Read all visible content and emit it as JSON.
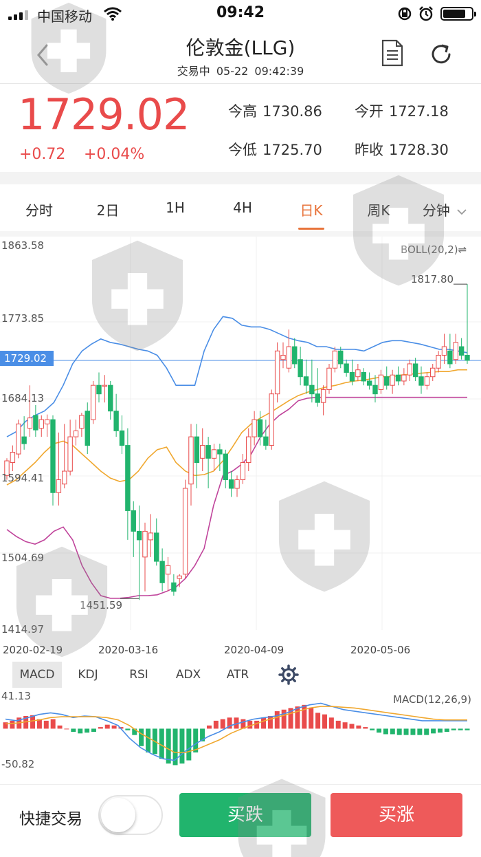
{
  "status_bar": {
    "carrier": "中国移动",
    "time": "09:42"
  },
  "header": {
    "title": "伦敦金(LLG)",
    "status": "交易中",
    "date": "05-22",
    "clock": "09:42:39"
  },
  "quote": {
    "price": "1729.02",
    "change": "+0.72",
    "change_pct": "+0.04%",
    "high_label": "今高",
    "high": "1730.86",
    "open_label": "今开",
    "open": "1727.18",
    "low_label": "今低",
    "low": "1725.70",
    "prev_close_label": "昨收",
    "prev_close": "1728.30"
  },
  "period_tabs": [
    {
      "label": "分时"
    },
    {
      "label": "2日"
    },
    {
      "label": "1H"
    },
    {
      "label": "4H"
    },
    {
      "label": "日K",
      "active": true
    },
    {
      "label": "周K"
    },
    {
      "label": "分钟"
    }
  ],
  "chart": {
    "overlay_label": "BOLL(20,2)",
    "current_price_tag": "1729.02",
    "max_annotation": "1817.80",
    "min_annotation": "1451.59",
    "y_ticks": [
      "1863.58",
      "1773.85",
      "1684.13",
      "1594.41",
      "1504.69",
      "1414.97"
    ],
    "x_ticks": [
      "2020-02-19",
      "2020-03-16",
      "2020-04-09",
      "2020-05-06"
    ],
    "colors": {
      "up": "#e94b4b",
      "down": "#21b46d",
      "upper": "#4a8ee6",
      "mid": "#f0a830",
      "lower": "#c0449b"
    }
  },
  "indicator_tabs": [
    {
      "label": "MACD",
      "active": true
    },
    {
      "label": "KDJ"
    },
    {
      "label": "RSI"
    },
    {
      "label": "ADX"
    },
    {
      "label": "ATR"
    }
  ],
  "macd": {
    "label": "MACD(12,26,9)",
    "top": "41.13",
    "bottom": "-50.82"
  },
  "chart_data": {
    "type": "candlestick",
    "title": "伦敦金(LLG) 日K",
    "x_range": [
      "2020-02-19",
      "2020-05-22"
    ],
    "ylim": [
      1414.97,
      1863.58
    ],
    "ohlc": [
      [
        1595,
        1615,
        1590,
        1612
      ],
      [
        1610,
        1630,
        1600,
        1622
      ],
      [
        1620,
        1660,
        1615,
        1655
      ],
      [
        1640,
        1664,
        1625,
        1632
      ],
      [
        1650,
        1700,
        1640,
        1662
      ],
      [
        1665,
        1677,
        1640,
        1648
      ],
      [
        1650,
        1665,
        1640,
        1660
      ],
      [
        1655,
        1666,
        1640,
        1660
      ],
      [
        1660,
        1665,
        1560,
        1575
      ],
      [
        1575,
        1645,
        1560,
        1590
      ],
      [
        1585,
        1655,
        1580,
        1600
      ],
      [
        1600,
        1660,
        1595,
        1640
      ],
      [
        1640,
        1660,
        1630,
        1647
      ],
      [
        1650,
        1668,
        1640,
        1665
      ],
      [
        1670,
        1680,
        1620,
        1630
      ],
      [
        1660,
        1705,
        1655,
        1700
      ],
      [
        1700,
        1715,
        1680,
        1690
      ],
      [
        1700,
        1712,
        1680,
        1700
      ],
      [
        1700,
        1705,
        1660,
        1670
      ],
      [
        1670,
        1690,
        1640,
        1647
      ],
      [
        1647,
        1665,
        1620,
        1630
      ],
      [
        1630,
        1650,
        1520,
        1554
      ],
      [
        1554,
        1565,
        1500,
        1530
      ],
      [
        1530,
        1560,
        1450,
        1520
      ],
      [
        1500,
        1540,
        1460,
        1530
      ],
      [
        1520,
        1550,
        1500,
        1528
      ],
      [
        1528,
        1545,
        1490,
        1495
      ],
      [
        1495,
        1510,
        1460,
        1470
      ],
      [
        1480,
        1500,
        1460,
        1490
      ],
      [
        1470,
        1480,
        1455,
        1460
      ],
      [
        1475,
        1480,
        1465,
        1478
      ],
      [
        1480,
        1590,
        1475,
        1580
      ],
      [
        1585,
        1655,
        1560,
        1640
      ],
      [
        1640,
        1655,
        1580,
        1610
      ],
      [
        1615,
        1650,
        1600,
        1630
      ],
      [
        1630,
        1640,
        1580,
        1615
      ],
      [
        1615,
        1632,
        1600,
        1625
      ],
      [
        1625,
        1632,
        1600,
        1620
      ],
      [
        1620,
        1625,
        1580,
        1590
      ],
      [
        1590,
        1600,
        1570,
        1580
      ],
      [
        1580,
        1595,
        1570,
        1590
      ],
      [
        1590,
        1620,
        1585,
        1610
      ],
      [
        1610,
        1650,
        1600,
        1640
      ],
      [
        1640,
        1670,
        1630,
        1660
      ],
      [
        1660,
        1670,
        1630,
        1640
      ],
      [
        1640,
        1660,
        1625,
        1630
      ],
      [
        1630,
        1695,
        1625,
        1690
      ],
      [
        1690,
        1750,
        1680,
        1740
      ],
      [
        1730,
        1750,
        1720,
        1735
      ],
      [
        1720,
        1765,
        1715,
        1745
      ],
      [
        1745,
        1755,
        1720,
        1725
      ],
      [
        1730,
        1745,
        1700,
        1710
      ],
      [
        1710,
        1730,
        1690,
        1700
      ],
      [
        1700,
        1730,
        1680,
        1690
      ],
      [
        1690,
        1720,
        1675,
        1680
      ],
      [
        1680,
        1700,
        1665,
        1695
      ],
      [
        1695,
        1725,
        1690,
        1720
      ],
      [
        1720,
        1745,
        1715,
        1740
      ],
      [
        1740,
        1745,
        1720,
        1725
      ],
      [
        1725,
        1730,
        1710,
        1715
      ],
      [
        1715,
        1730,
        1700,
        1705
      ],
      [
        1710,
        1725,
        1705,
        1718
      ],
      [
        1715,
        1720,
        1700,
        1705
      ],
      [
        1705,
        1715,
        1695,
        1700
      ],
      [
        1700,
        1712,
        1680,
        1690
      ],
      [
        1695,
        1718,
        1690,
        1712
      ],
      [
        1710,
        1722,
        1695,
        1700
      ],
      [
        1700,
        1718,
        1690,
        1712
      ],
      [
        1712,
        1722,
        1700,
        1705
      ],
      [
        1705,
        1720,
        1700,
        1712
      ],
      [
        1712,
        1730,
        1705,
        1725
      ],
      [
        1725,
        1732,
        1705,
        1710
      ],
      [
        1710,
        1722,
        1690,
        1700
      ],
      [
        1700,
        1715,
        1695,
        1710
      ],
      [
        1710,
        1725,
        1705,
        1720
      ],
      [
        1720,
        1740,
        1715,
        1735
      ],
      [
        1735,
        1760,
        1725,
        1745
      ],
      [
        1740,
        1760,
        1720,
        1725
      ],
      [
        1730,
        1760,
        1725,
        1750
      ],
      [
        1745,
        1755,
        1730,
        1735
      ],
      [
        1735,
        1817.8,
        1725,
        1729.02
      ]
    ],
    "series": [
      {
        "name": "BOLL upper",
        "values": [
          1640,
          1646,
          1658,
          1665,
          1670,
          1680,
          1700,
          1725,
          1740,
          1748,
          1754,
          1750,
          1748,
          1745,
          1742,
          1740,
          1735,
          1720,
          1700,
          1700,
          1700,
          1740,
          1765,
          1780,
          1778,
          1770,
          1768,
          1768,
          1765,
          1760,
          1755,
          1752,
          1750,
          1745,
          1745,
          1742,
          1742,
          1742,
          1740,
          1745,
          1750,
          1752,
          1752,
          1750,
          1748,
          1745,
          1742,
          1742,
          1740,
          1738
        ]
      },
      {
        "name": "BOLL mid",
        "values": [
          1584,
          1590,
          1600,
          1610,
          1622,
          1632,
          1635,
          1630,
          1620,
          1610,
          1600,
          1592,
          1588,
          1590,
          1600,
          1615,
          1625,
          1628,
          1610,
          1600,
          1595,
          1596,
          1600,
          1612,
          1628,
          1645,
          1655,
          1662,
          1668,
          1675,
          1682,
          1688,
          1692,
          1695,
          1698,
          1700,
          1703,
          1705,
          1706,
          1708,
          1710,
          1710,
          1712,
          1713,
          1714,
          1715,
          1716,
          1716,
          1718,
          1718
        ]
      },
      {
        "name": "BOLL lower",
        "values": [
          1532,
          1524,
          1518,
          1515,
          1520,
          1530,
          1535,
          1520,
          1490,
          1470,
          1455,
          1452,
          1452,
          1453,
          1455,
          1455,
          1456,
          1460,
          1465,
          1475,
          1490,
          1510,
          1560,
          1595,
          1600,
          1608,
          1620,
          1640,
          1655,
          1665,
          1672,
          1682,
          1685,
          1686,
          1686,
          1686,
          1686,
          1686,
          1686,
          1686,
          1686,
          1686,
          1686,
          1686,
          1686,
          1686,
          1686,
          1686,
          1686,
          1686
        ]
      }
    ],
    "macd": {
      "ylim": [
        -50.82,
        41.13
      ],
      "hist": [
        8,
        10,
        14,
        16,
        17,
        12,
        10,
        12,
        4,
        0,
        -4,
        -6,
        -5,
        -4,
        2,
        5,
        4,
        2,
        -2,
        -8,
        -22,
        -30,
        -32,
        -38,
        -44,
        -46,
        -44,
        -40,
        -30,
        -16,
        4,
        10,
        12,
        14,
        14,
        12,
        10,
        10,
        14,
        16,
        22,
        24,
        26,
        28,
        30,
        26,
        20,
        18,
        14,
        10,
        8,
        6,
        4,
        2,
        -2,
        -5,
        -7,
        -7,
        -8,
        -8,
        -8,
        -8,
        -8,
        -6,
        -5,
        -4,
        -2,
        -2,
        -2
      ],
      "dif": [
        12,
        10,
        14,
        18,
        20,
        18,
        14,
        16,
        15,
        10,
        4,
        -12,
        -24,
        -32,
        -38,
        -40,
        -28,
        -18,
        -10,
        -4,
        4,
        8,
        12,
        14,
        16,
        20,
        26,
        30,
        32,
        28,
        24,
        22,
        20,
        18,
        16,
        14,
        12,
        10,
        10,
        10,
        10,
        10
      ],
      "dea": [
        6,
        7,
        9,
        11,
        14,
        15,
        15,
        15,
        15,
        14,
        11,
        4,
        -6,
        -14,
        -22,
        -30,
        -30,
        -26,
        -20,
        -14,
        -6,
        0,
        5,
        10,
        14,
        18,
        22,
        26,
        28,
        28,
        27,
        26,
        24,
        22,
        20,
        18,
        16,
        14,
        12,
        11,
        11,
        11
      ]
    }
  },
  "bottom_bar": {
    "quick_trade": "快捷交易",
    "sell": "买跌",
    "buy": "买涨"
  }
}
